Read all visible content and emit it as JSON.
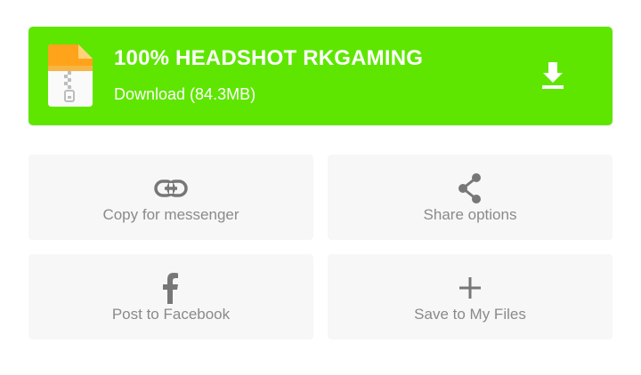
{
  "banner": {
    "title": "100% HEADSHOT RKGAMING",
    "subtitle": "Download (84.3MB)",
    "color": "#5ee600",
    "file_icon": "zip-file-icon",
    "download_icon": "download-icon"
  },
  "actions": [
    {
      "label": "Copy for messenger",
      "icon": "link-icon"
    },
    {
      "label": "Share options",
      "icon": "share-icon"
    },
    {
      "label": "Post to Facebook",
      "icon": "facebook-icon"
    },
    {
      "label": "Save to My Files",
      "icon": "plus-icon"
    }
  ]
}
